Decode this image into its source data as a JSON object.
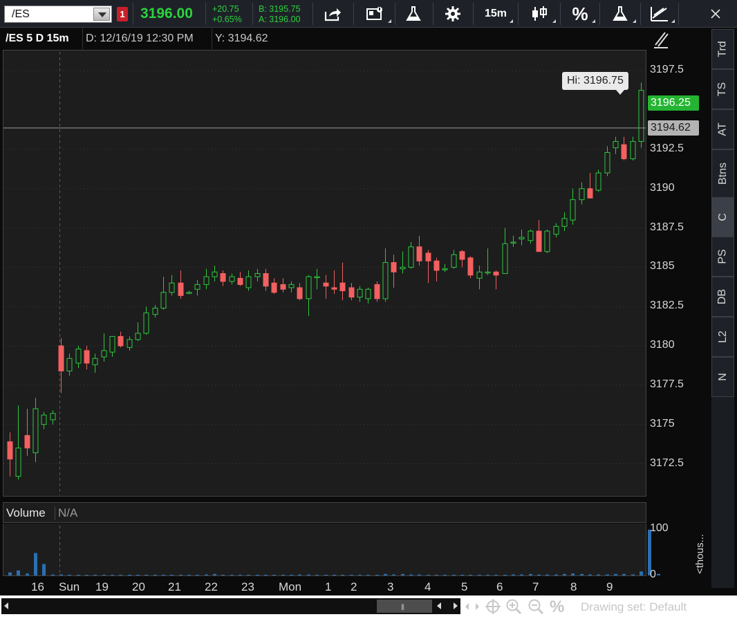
{
  "toolbar": {
    "symbol": "/ES",
    "alert_count": "1",
    "last_price": "3196.00",
    "net_change": "+20.75",
    "net_change_pct": "+0.65%",
    "bid": "B: 3195.75",
    "ask": "A: 3196.00",
    "timeframe": "15m",
    "percent_glyph": "%",
    "icons": [
      "share-icon",
      "message-icon",
      "studies-flask-icon",
      "settings-gear-icon",
      "candlestick-icon",
      "percent-icon",
      "strategies-flask-icon",
      "drawings-icon",
      "close-icon"
    ]
  },
  "header": {
    "symbol": "/ES 5 D 15m",
    "date": "D: 12/16/19 12:30 PM",
    "y_value": "Y: 3194.62"
  },
  "price_axis": {
    "last_badge": "3196.25",
    "crosshair_badge": "3194.62",
    "hi_label": "Hi: 3196.75",
    "colors": {
      "up": "#2ec93f",
      "down": "#f26060",
      "last_badge": "#25b432"
    }
  },
  "volume": {
    "label": "Volume",
    "na_label": "N/A",
    "units_label": "<thous...",
    "axis_top": "100",
    "axis_bottom": "0"
  },
  "side_tabs": [
    "Trd",
    "TS",
    "AT",
    "Btns",
    "C",
    "PS",
    "DB",
    "L2",
    "N"
  ],
  "bottom_bar": {
    "drawing_set": "Drawing set: Default",
    "percent_glyph": "%"
  },
  "chart_data": {
    "type": "candlestick",
    "symbol": "/ES",
    "interval": "15m",
    "y_ticks": [
      3172.5,
      3175,
      3177.5,
      3180,
      3182.5,
      3185,
      3187.5,
      3190,
      3192.5,
      3197.5
    ],
    "ylim": [
      3170.5,
      3198.7
    ],
    "crosshair_y": 3194.62,
    "session_divider_label": "Sun",
    "x_labels": [
      "16",
      "Sun",
      "19",
      "20",
      "21",
      "22",
      "23",
      "Mon",
      "1",
      "2",
      "3",
      "4",
      "5",
      "6",
      "7",
      "8",
      "9"
    ],
    "candles": [
      {
        "o": 3173.9,
        "h": 3174.5,
        "l": 3171.7,
        "c": 3172.8
      },
      {
        "o": 3171.7,
        "h": 3176.2,
        "l": 3171.5,
        "c": 3173.5
      },
      {
        "o": 3174.3,
        "h": 3176.0,
        "l": 3173.0,
        "c": 3173.5
      },
      {
        "o": 3173.2,
        "h": 3176.7,
        "l": 3172.6,
        "c": 3176.0
      },
      {
        "o": 3175.0,
        "h": 3175.8,
        "l": 3174.7,
        "c": 3175.6
      },
      {
        "o": 3175.3,
        "h": 3175.9,
        "l": 3175.0,
        "c": 3175.7
      },
      {
        "o": 3180.0,
        "h": 3180.5,
        "l": 3177.0,
        "c": 3178.4
      },
      {
        "o": 3178.4,
        "h": 3179.5,
        "l": 3178.1,
        "c": 3179.2
      },
      {
        "o": 3178.9,
        "h": 3180.0,
        "l": 3178.6,
        "c": 3179.8
      },
      {
        "o": 3179.7,
        "h": 3180.0,
        "l": 3178.5,
        "c": 3178.9
      },
      {
        "o": 3178.8,
        "h": 3179.5,
        "l": 3178.3,
        "c": 3179.2
      },
      {
        "o": 3179.3,
        "h": 3180.8,
        "l": 3179.0,
        "c": 3179.7
      },
      {
        "o": 3179.6,
        "h": 3180.4,
        "l": 3179.3,
        "c": 3180.6
      },
      {
        "o": 3180.6,
        "h": 3180.9,
        "l": 3179.9,
        "c": 3180.0
      },
      {
        "o": 3179.9,
        "h": 3180.6,
        "l": 3179.7,
        "c": 3180.4
      },
      {
        "o": 3180.4,
        "h": 3181.5,
        "l": 3180.3,
        "c": 3180.8
      },
      {
        "o": 3180.8,
        "h": 3182.5,
        "l": 3180.7,
        "c": 3182.1
      },
      {
        "o": 3182.0,
        "h": 3182.6,
        "l": 3181.8,
        "c": 3182.4
      },
      {
        "o": 3182.4,
        "h": 3184.4,
        "l": 3182.3,
        "c": 3183.4
      },
      {
        "o": 3183.4,
        "h": 3184.5,
        "l": 3183.2,
        "c": 3184.0
      },
      {
        "o": 3184.0,
        "h": 3184.8,
        "l": 3183.0,
        "c": 3183.2
      },
      {
        "o": 3183.4,
        "h": 3183.5,
        "l": 3183.3,
        "c": 3183.4
      },
      {
        "o": 3183.6,
        "h": 3184.2,
        "l": 3183.2,
        "c": 3183.9
      },
      {
        "o": 3183.9,
        "h": 3184.9,
        "l": 3183.6,
        "c": 3184.4
      },
      {
        "o": 3184.4,
        "h": 3185.1,
        "l": 3184.1,
        "c": 3184.7
      },
      {
        "o": 3184.6,
        "h": 3184.8,
        "l": 3183.8,
        "c": 3184.1
      },
      {
        "o": 3184.1,
        "h": 3184.6,
        "l": 3183.9,
        "c": 3184.4
      },
      {
        "o": 3184.3,
        "h": 3184.7,
        "l": 3183.8,
        "c": 3183.9
      },
      {
        "o": 3183.7,
        "h": 3184.8,
        "l": 3183.5,
        "c": 3184.4
      },
      {
        "o": 3184.4,
        "h": 3184.9,
        "l": 3184.1,
        "c": 3184.6
      },
      {
        "o": 3184.6,
        "h": 3184.9,
        "l": 3183.5,
        "c": 3183.8
      },
      {
        "o": 3184.0,
        "h": 3184.3,
        "l": 3183.3,
        "c": 3183.4
      },
      {
        "o": 3183.9,
        "h": 3184.3,
        "l": 3183.4,
        "c": 3183.6
      },
      {
        "o": 3183.7,
        "h": 3184.1,
        "l": 3183.4,
        "c": 3183.9
      },
      {
        "o": 3183.7,
        "h": 3184.0,
        "l": 3182.9,
        "c": 3183.0
      },
      {
        "o": 3183.0,
        "h": 3184.5,
        "l": 3181.9,
        "c": 3184.4
      },
      {
        "o": 3184.4,
        "h": 3184.9,
        "l": 3183.6,
        "c": 3184.4
      },
      {
        "o": 3184.0,
        "h": 3184.5,
        "l": 3183.0,
        "c": 3183.8
      },
      {
        "o": 3183.7,
        "h": 3184.8,
        "l": 3183.3,
        "c": 3183.6
      },
      {
        "o": 3184.0,
        "h": 3185.3,
        "l": 3182.9,
        "c": 3183.5
      },
      {
        "o": 3183.7,
        "h": 3184.0,
        "l": 3182.9,
        "c": 3183.1
      },
      {
        "o": 3183.1,
        "h": 3183.8,
        "l": 3182.8,
        "c": 3183.6
      },
      {
        "o": 3183.0,
        "h": 3183.7,
        "l": 3182.7,
        "c": 3183.6
      },
      {
        "o": 3183.9,
        "h": 3184.1,
        "l": 3182.8,
        "c": 3183.0
      },
      {
        "o": 3183.0,
        "h": 3186.2,
        "l": 3182.8,
        "c": 3185.3
      },
      {
        "o": 3185.3,
        "h": 3185.8,
        "l": 3183.7,
        "c": 3184.7
      },
      {
        "o": 3184.9,
        "h": 3186.0,
        "l": 3184.6,
        "c": 3185.0
      },
      {
        "o": 3185.0,
        "h": 3186.6,
        "l": 3184.9,
        "c": 3186.3
      },
      {
        "o": 3186.3,
        "h": 3187.0,
        "l": 3185.1,
        "c": 3185.4
      },
      {
        "o": 3185.9,
        "h": 3186.1,
        "l": 3184.0,
        "c": 3185.4
      },
      {
        "o": 3185.4,
        "h": 3185.6,
        "l": 3184.1,
        "c": 3184.8
      },
      {
        "o": 3184.9,
        "h": 3185.2,
        "l": 3184.7,
        "c": 3184.9
      },
      {
        "o": 3185.0,
        "h": 3186.1,
        "l": 3184.9,
        "c": 3185.8
      },
      {
        "o": 3186.0,
        "h": 3186.1,
        "l": 3185.0,
        "c": 3185.5
      },
      {
        "o": 3185.6,
        "h": 3185.7,
        "l": 3184.3,
        "c": 3184.5
      },
      {
        "o": 3184.3,
        "h": 3185.1,
        "l": 3183.6,
        "c": 3184.7
      },
      {
        "o": 3184.7,
        "h": 3186.2,
        "l": 3184.5,
        "c": 3184.7
      },
      {
        "o": 3184.7,
        "h": 3184.8,
        "l": 3183.6,
        "c": 3184.5
      },
      {
        "o": 3184.6,
        "h": 3187.5,
        "l": 3184.6,
        "c": 3186.5
      },
      {
        "o": 3186.6,
        "h": 3187.0,
        "l": 3186.3,
        "c": 3186.6
      },
      {
        "o": 3186.8,
        "h": 3187.4,
        "l": 3186.4,
        "c": 3186.9
      },
      {
        "o": 3186.7,
        "h": 3187.4,
        "l": 3186.5,
        "c": 3187.3
      },
      {
        "o": 3187.3,
        "h": 3188.0,
        "l": 3186.0,
        "c": 3186.0
      },
      {
        "o": 3186.0,
        "h": 3187.4,
        "l": 3185.9,
        "c": 3187.3
      },
      {
        "o": 3187.1,
        "h": 3187.8,
        "l": 3186.9,
        "c": 3187.6
      },
      {
        "o": 3187.6,
        "h": 3188.5,
        "l": 3187.3,
        "c": 3188.1
      },
      {
        "o": 3188.0,
        "h": 3190.0,
        "l": 3187.7,
        "c": 3189.3
      },
      {
        "o": 3189.3,
        "h": 3190.4,
        "l": 3189.0,
        "c": 3190.0
      },
      {
        "o": 3190.0,
        "h": 3191.0,
        "l": 3189.4,
        "c": 3189.4
      },
      {
        "o": 3189.9,
        "h": 3191.2,
        "l": 3189.8,
        "c": 3191.0
      },
      {
        "o": 3191.0,
        "h": 3192.7,
        "l": 3190.8,
        "c": 3192.3
      },
      {
        "o": 3192.6,
        "h": 3193.3,
        "l": 3192.2,
        "c": 3193.0
      },
      {
        "o": 3192.8,
        "h": 3193.3,
        "l": 3191.8,
        "c": 3191.9
      },
      {
        "o": 3191.9,
        "h": 3193.3,
        "l": 3191.8,
        "c": 3193.0
      },
      {
        "o": 3193.0,
        "h": 3196.75,
        "l": 3192.6,
        "c": 3196.25
      }
    ],
    "volume": [
      6,
      10,
      4,
      45,
      23,
      2,
      2,
      1,
      1,
      1,
      1,
      1,
      1,
      1,
      1,
      1,
      1,
      1,
      1,
      1,
      1,
      1,
      1,
      2,
      3,
      1,
      1,
      1,
      1,
      1,
      1,
      1,
      1,
      1,
      2,
      2,
      1,
      1,
      1,
      1,
      1,
      1,
      1,
      1,
      3,
      2,
      3,
      2,
      2,
      1,
      1,
      1,
      1,
      1,
      1,
      1,
      1,
      1,
      1,
      2,
      2,
      3,
      2,
      2,
      2,
      3,
      4,
      3,
      2,
      2,
      2,
      3,
      3,
      2,
      8,
      92,
      3
    ]
  }
}
